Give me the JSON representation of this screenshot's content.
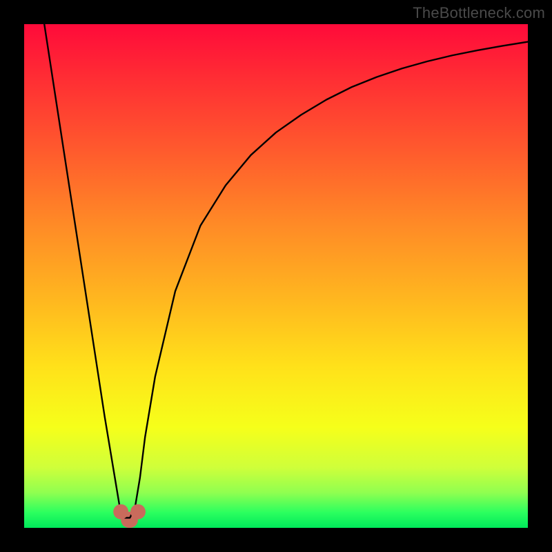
{
  "watermark": "TheBottleneck.com",
  "chart_data": {
    "type": "line",
    "title": "",
    "xlabel": "",
    "ylabel": "",
    "xlim": [
      0,
      100
    ],
    "ylim": [
      0,
      100
    ],
    "grid": false,
    "gradient_stops": [
      {
        "offset": 0.0,
        "color": "#ff0a3a"
      },
      {
        "offset": 0.1,
        "color": "#ff2b34"
      },
      {
        "offset": 0.25,
        "color": "#ff5a2d"
      },
      {
        "offset": 0.4,
        "color": "#ff8b26"
      },
      {
        "offset": 0.55,
        "color": "#ffb81f"
      },
      {
        "offset": 0.68,
        "color": "#ffe11a"
      },
      {
        "offset": 0.8,
        "color": "#f6ff1a"
      },
      {
        "offset": 0.88,
        "color": "#cfff3a"
      },
      {
        "offset": 0.93,
        "color": "#90ff50"
      },
      {
        "offset": 0.97,
        "color": "#2aff5f"
      },
      {
        "offset": 1.0,
        "color": "#00e85a"
      }
    ],
    "series": [
      {
        "name": "bottleneck-curve",
        "color": "#000000",
        "x": [
          4.0,
          6,
          8,
          10,
          12,
          14,
          16,
          18,
          19,
          20,
          21,
          22,
          23,
          24,
          26,
          30,
          35,
          40,
          45,
          50,
          55,
          60,
          65,
          70,
          75,
          80,
          85,
          90,
          95,
          100
        ],
        "y": [
          100,
          87,
          74,
          61,
          48,
          35,
          22,
          10,
          4,
          2,
          2,
          4,
          10,
          18,
          30,
          47,
          60,
          68,
          74,
          78.5,
          82,
          85,
          87.5,
          89.5,
          91.2,
          92.6,
          93.8,
          94.8,
          95.7,
          96.5
        ]
      }
    ],
    "markers": [
      {
        "name": "min-left",
        "x": 19.2,
        "y": 3.2,
        "r": 1.5,
        "color": "#c96b5c"
      },
      {
        "name": "min-right",
        "x": 22.6,
        "y": 3.2,
        "r": 1.5,
        "color": "#c96b5c"
      }
    ],
    "trough_bar": {
      "x0": 19.2,
      "x1": 22.6,
      "y": 1.6,
      "height": 3.2,
      "color": "#c96b5c"
    }
  }
}
